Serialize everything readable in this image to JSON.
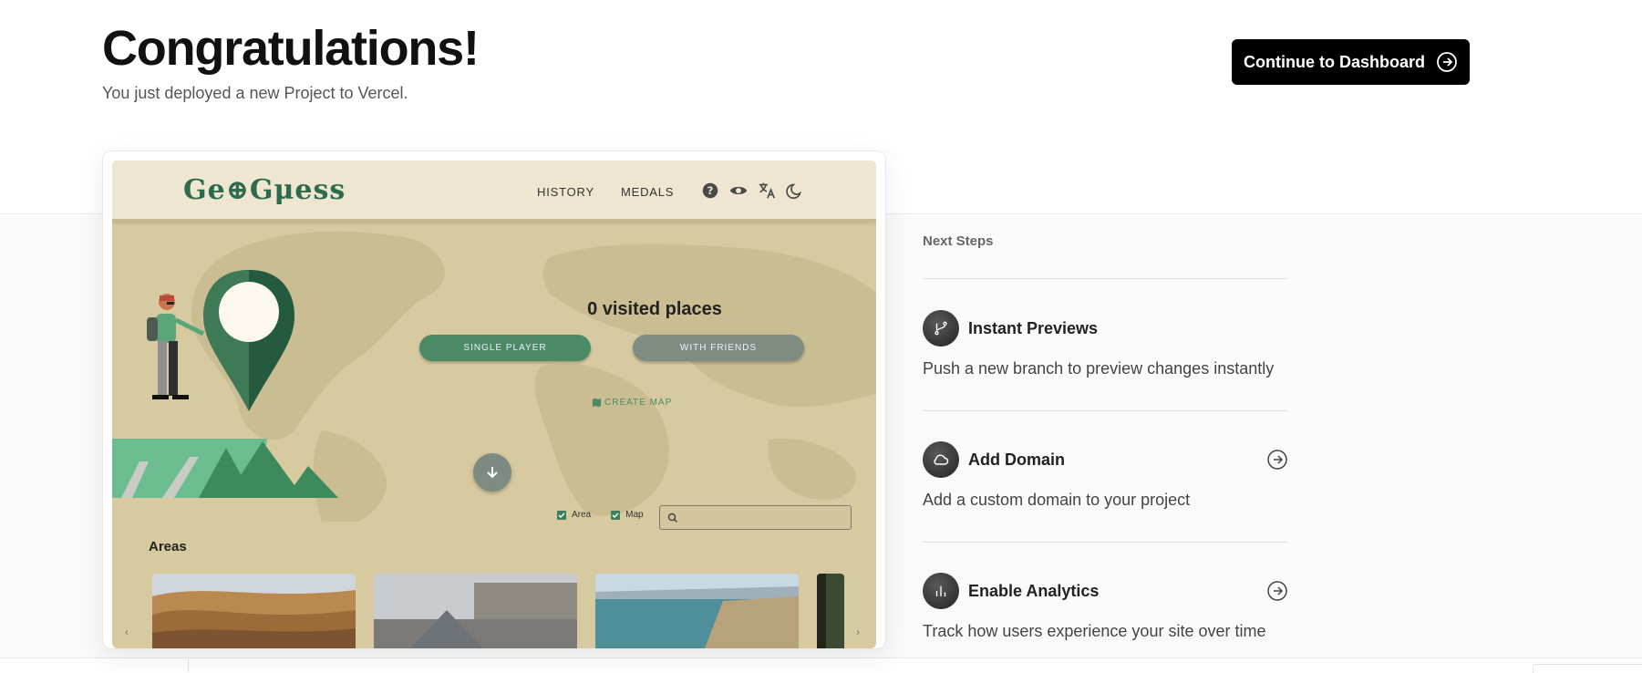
{
  "header": {
    "title": "Congratulations!",
    "subtitle": "You just deployed a new Project to Vercel.",
    "cta_label": "Continue to Dashboard"
  },
  "preview": {
    "logo_text": "Ge⊕Gμess",
    "nav": {
      "history": "HISTORY",
      "medals": "MEDALS"
    },
    "nav_icons": [
      "help-icon",
      "eye-icon",
      "translate-icon",
      "moon-icon"
    ],
    "visited": "0 visited places",
    "single_player": "SINGLE PLAYER",
    "with_friends": "WITH FRIENDS",
    "create_map": "CREATE MAP",
    "filters": {
      "area": "Area",
      "map": "Map"
    },
    "areas_heading": "Areas",
    "thumbnails": [
      "desert-dunes",
      "louvre-pyramid",
      "coastal-bay",
      "cliff-forest"
    ]
  },
  "next_steps": {
    "title": "Next Steps",
    "items": [
      {
        "icon": "git-branch-icon",
        "title": "Instant Previews",
        "desc": "Push a new branch to preview changes instantly",
        "has_arrow": false
      },
      {
        "icon": "cloud-icon",
        "title": "Add Domain",
        "desc": "Add a custom domain to your project",
        "has_arrow": true
      },
      {
        "icon": "bar-chart-icon",
        "title": "Enable Analytics",
        "desc": "Track how users experience your site over time",
        "has_arrow": true
      }
    ]
  },
  "colors": {
    "cta_bg": "#000000",
    "geo_green": "#4a8a65",
    "geo_bg": "#d8caa0",
    "geo_nav_bg": "#efe6d2"
  }
}
